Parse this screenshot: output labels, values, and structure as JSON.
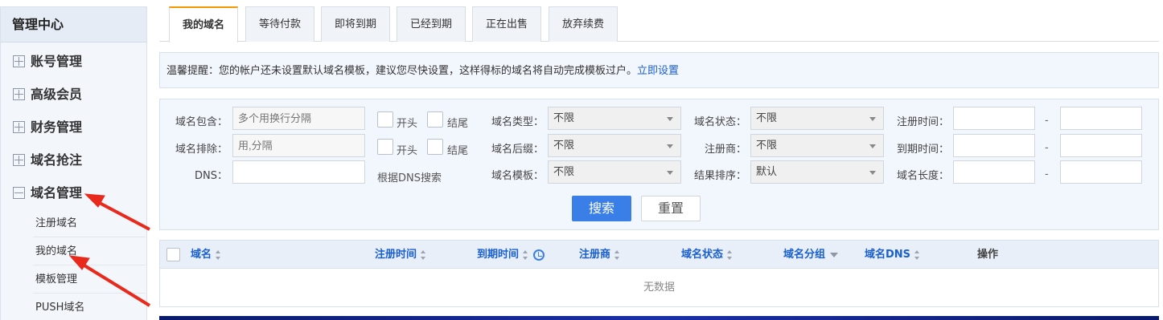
{
  "sidebar": {
    "title": "管理中心",
    "items": [
      {
        "label": "账号管理"
      },
      {
        "label": "高级会员"
      },
      {
        "label": "财务管理"
      },
      {
        "label": "域名抢注"
      },
      {
        "label": "域名管理"
      }
    ],
    "subitems": [
      {
        "label": "注册域名"
      },
      {
        "label": "我的域名"
      },
      {
        "label": "模板管理"
      },
      {
        "label": "PUSH域名"
      }
    ]
  },
  "tabs": [
    {
      "label": "我的域名"
    },
    {
      "label": "等待付款"
    },
    {
      "label": "即将到期"
    },
    {
      "label": "已经到期"
    },
    {
      "label": "正在出售"
    },
    {
      "label": "放弃续费"
    }
  ],
  "notice": {
    "text": "温馨提醒：您的帐户还未设置默认域名模板，建议您尽快设置，这样得标的域名将自动完成模板过户。",
    "link": "立即设置"
  },
  "filter": {
    "contains_label": "域名包含：",
    "contains_placeholder": "多个用换行分隔",
    "exclude_label": "域名排除：",
    "exclude_placeholder": "用,分隔",
    "dns_label": "DNS：",
    "check_start": "开头",
    "check_end": "结尾",
    "dns_search_text": "根据DNS搜索",
    "type_label": "域名类型：",
    "type_value": "不限",
    "suffix_label": "域名后缀：",
    "suffix_value": "不限",
    "template_label": "域名模板：",
    "template_value": "不限",
    "status_label": "域名状态：",
    "status_value": "不限",
    "registrar_label": "注册商：",
    "registrar_value": "不限",
    "sort_label": "结果排序：",
    "sort_value": "默认",
    "reg_time_label": "注册时间：",
    "exp_time_label": "到期时间：",
    "length_label": "域名长度：",
    "range_sep": "-",
    "search_button": "搜索",
    "reset_button": "重置"
  },
  "table": {
    "columns": [
      "域名",
      "注册时间",
      "到期时间",
      "注册商",
      "域名状态",
      "域名分组",
      "域名DNS",
      "操作"
    ],
    "empty_text": "无数据"
  }
}
